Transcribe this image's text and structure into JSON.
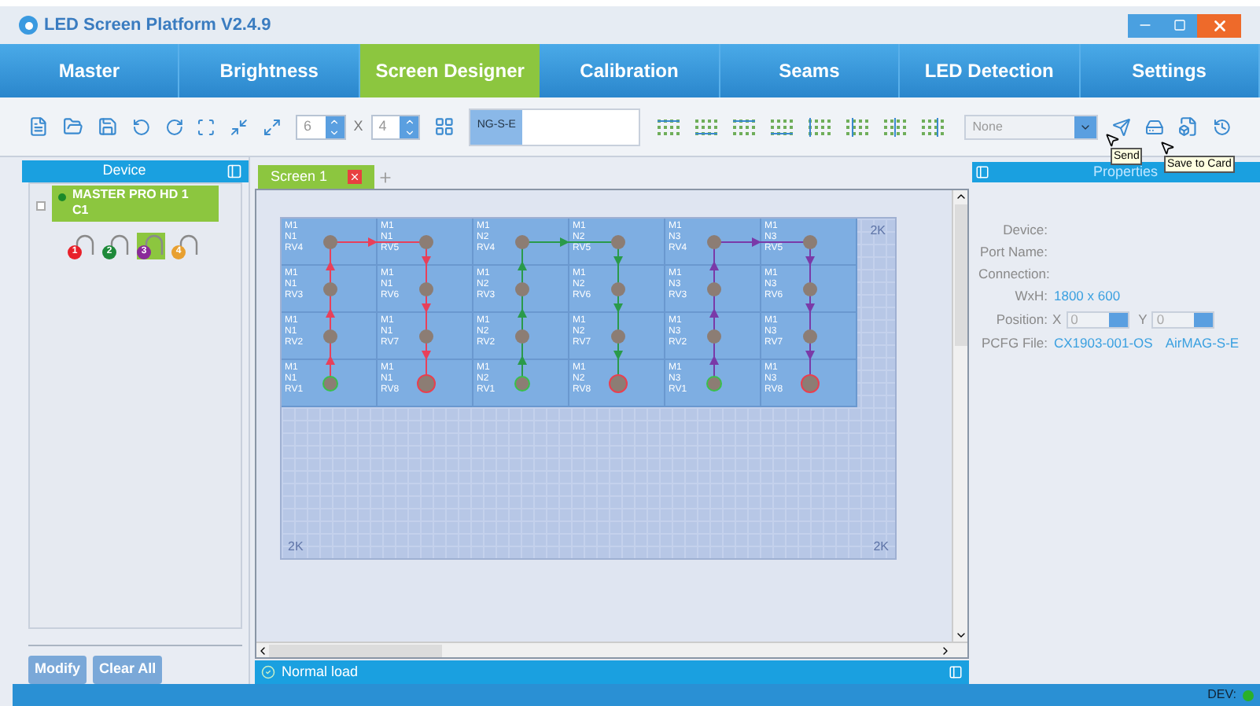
{
  "window": {
    "title": "LED Screen Platform V2.4.9"
  },
  "nav_tabs": [
    {
      "label": "Master",
      "selected": false
    },
    {
      "label": "Brightness",
      "selected": false
    },
    {
      "label": "Screen Designer",
      "selected": true
    },
    {
      "label": "Calibration",
      "selected": false
    },
    {
      "label": "Seams",
      "selected": false
    },
    {
      "label": "LED Detection",
      "selected": false
    },
    {
      "label": "Settings",
      "selected": false
    }
  ],
  "toolbar": {
    "rows_value": "6",
    "times_sign": "X",
    "cols_value": "4",
    "template": "NG-S-E",
    "mode_dropdown": "None"
  },
  "tooltips": [
    {
      "text": "Send"
    },
    {
      "text": "Save to Card"
    }
  ],
  "device_panel": {
    "title": "Device",
    "device": {
      "name": "MASTER PRO HD 1",
      "subtitle": "C1",
      "online": true,
      "checked": false
    },
    "ports": [
      {
        "number": "1",
        "color": "#e8202a",
        "selected": false
      },
      {
        "number": "2",
        "color": "#1e8a3a",
        "selected": false
      },
      {
        "number": "3",
        "color": "#8a2a9a",
        "selected": true
      },
      {
        "number": "4",
        "color": "#e8a030",
        "selected": false
      }
    ],
    "buttons": [
      "Modify",
      "Clear All"
    ]
  },
  "screen_tabs": [
    {
      "label": "Screen 1",
      "selected": true
    }
  ],
  "layout": {
    "routes": [
      {
        "color": "#e8405a"
      },
      {
        "color": "#2a9a4a"
      },
      {
        "color": "#7a3aa8"
      }
    ],
    "cells": [
      [
        "M1\nN1\nRV4",
        "M1\nN1\nRV5",
        "M1\nN2\nRV4",
        "M1\nN2\nRV5",
        "M1\nN3\nRV4",
        "M1\nN3\nRV5"
      ],
      [
        "M1\nN1\nRV3",
        "M1\nN1\nRV6",
        "M1\nN2\nRV3",
        "M1\nN2\nRV6",
        "M1\nN3\nRV3",
        "M1\nN3\nRV6"
      ],
      [
        "M1\nN1\nRV2",
        "M1\nN1\nRV7",
        "M1\nN2\nRV2",
        "M1\nN2\nRV7",
        "M1\nN3\nRV2",
        "M1\nN3\nRV7"
      ],
      [
        "M1\nN1\nRV1",
        "M1\nN1\nRV8",
        "M1\nN2\nRV1",
        "M1\nN2\nRV8",
        "M1\nN3\nRV1",
        "M1\nN3\nRV8"
      ]
    ],
    "corner_marks": [
      "2K",
      "2K",
      "2K"
    ]
  },
  "load_status": "Normal load",
  "properties": {
    "title": "Properties",
    "fields": [
      {
        "kind": "text",
        "label": "Device:"
      },
      {
        "kind": "text",
        "label": "Port Name:"
      },
      {
        "kind": "text",
        "label": "Connection:"
      },
      {
        "kind": "text",
        "label": "WxH:",
        "values": [
          "1800 x 600"
        ]
      },
      {
        "kind": "position",
        "label": "Position:",
        "x_label": "X",
        "x_value": "0",
        "y_label": "Y",
        "y_value": "0"
      },
      {
        "kind": "text",
        "label": "PCFG File:",
        "values": [
          "CX1903-001-OS",
          "AirMAG-S-E"
        ]
      }
    ]
  },
  "status_bar": {
    "label": "DEV:",
    "connected": true
  }
}
